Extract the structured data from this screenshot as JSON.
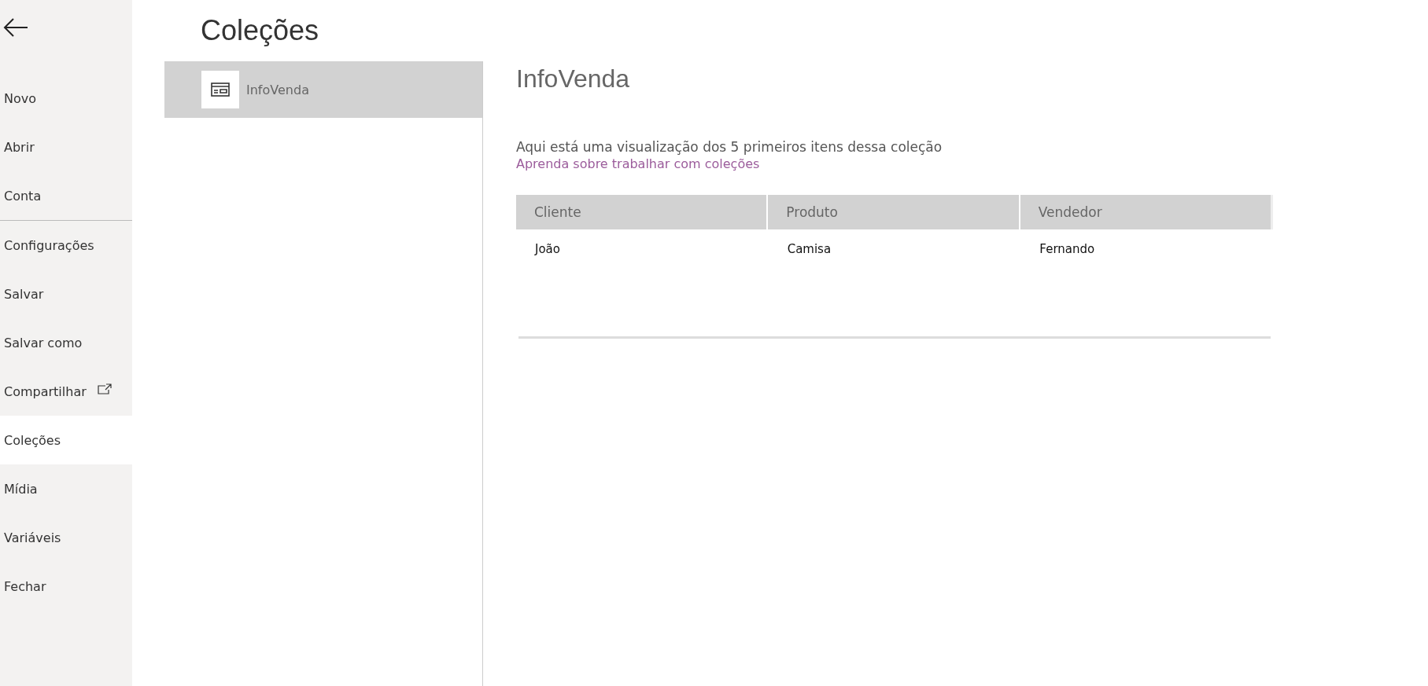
{
  "sidebar": {
    "items": [
      {
        "label": "Novo",
        "selected": false,
        "external": false,
        "divider_after": false
      },
      {
        "label": "Abrir",
        "selected": false,
        "external": false,
        "divider_after": false
      },
      {
        "label": "Conta",
        "selected": false,
        "external": false,
        "divider_after": true
      },
      {
        "label": "Configurações",
        "selected": false,
        "external": false,
        "divider_after": false
      },
      {
        "label": "Salvar",
        "selected": false,
        "external": false,
        "divider_after": false
      },
      {
        "label": "Salvar como",
        "selected": false,
        "external": false,
        "divider_after": false
      },
      {
        "label": "Compartilhar",
        "selected": false,
        "external": true,
        "divider_after": false
      },
      {
        "label": "Coleções",
        "selected": true,
        "external": false,
        "divider_after": false
      },
      {
        "label": "Mídia",
        "selected": false,
        "external": false,
        "divider_after": false
      },
      {
        "label": "Variáveis",
        "selected": false,
        "external": false,
        "divider_after": false
      },
      {
        "label": "Fechar",
        "selected": false,
        "external": false,
        "divider_after": false
      }
    ]
  },
  "page_title": "Coleções",
  "collections": [
    {
      "name": "InfoVenda",
      "selected": true
    }
  ],
  "detail": {
    "title": "InfoVenda",
    "description": "Aqui está uma visualização dos 5 primeiros itens dessa coleção",
    "link": "Aprenda sobre trabalhar com coleções",
    "table": {
      "columns": [
        "Cliente",
        "Produto",
        "Vendedor"
      ],
      "rows": [
        [
          "João",
          "Camisa",
          "Fernando"
        ]
      ]
    }
  }
}
